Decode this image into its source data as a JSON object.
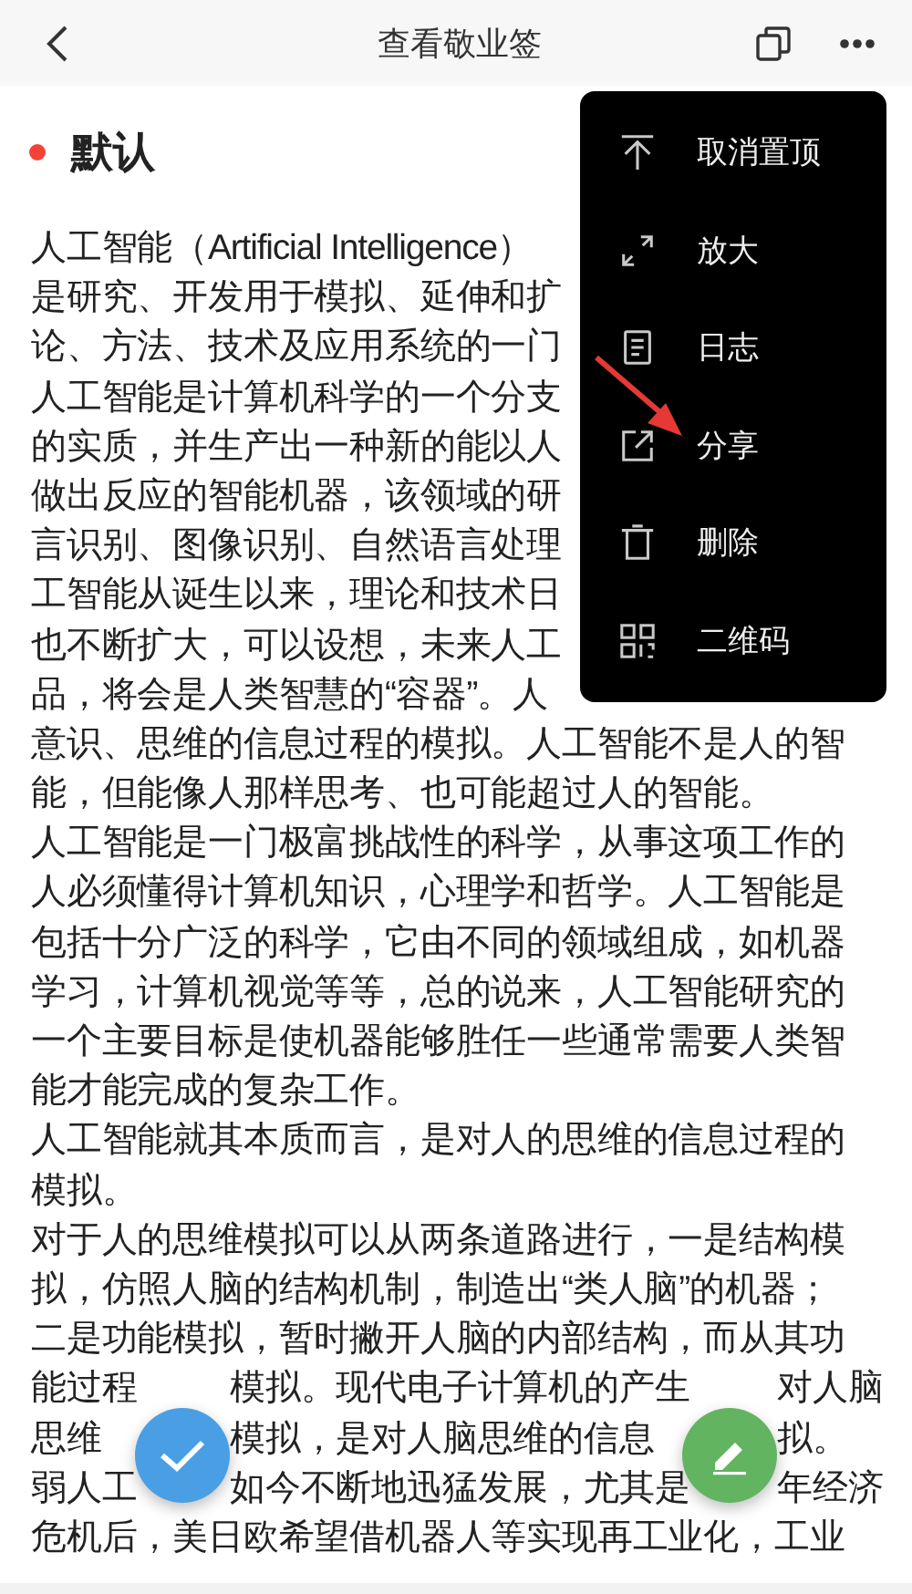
{
  "header": {
    "title": "查看敬业签"
  },
  "note": {
    "category": "默认",
    "lines": [
      [
        "人工智能（Artificial Intelligence）"
      ],
      [
        "是研究、开发用于模拟、延伸和扩"
      ],
      [
        "论、方法、技术及应用系统的一门"
      ],
      [
        "人工智能是计算机科学的一个分支"
      ],
      [
        "的实质，并生产出一种新的能以人"
      ],
      [
        "做出反应的智能机器，该领域的研"
      ],
      [
        "言识别、图像识别、自然语言处理"
      ],
      [
        "工智能从诞生以来，理论和技术日"
      ],
      [
        "也不断扩大，可以设想，未来人工"
      ],
      [
        "品，将会是人类智慧的“容器”。人"
      ],
      [
        "意识、思维的信息过程的模拟。人工智能不是人的智"
      ],
      [
        "能，但能像人那样思考、也可能超过人的智能。"
      ],
      [
        "人工智能是一门极富挑战性的科学，从事这项工作的"
      ],
      [
        "人必须懂得计算机知识，心理学和哲学。人工智能是"
      ],
      [
        "包括十分广泛的科学，它由不同的领域组成，如机器"
      ],
      [
        "学习，计算机视觉等等，总的说来，人工智能研究的"
      ],
      [
        "一个主要目标是使机器能够胜任一些通常需要人类智"
      ],
      [
        "能才能完成的复杂工作。"
      ],
      [
        "人工智能就其本质而言，是对人的思维的信息过程的"
      ],
      [
        "模拟。"
      ],
      [
        "对于人的思维模拟可以从两条道路进行，一是结构模"
      ],
      [
        "拟，仿照人脑的结构机制，制造出“类人脑”的机器；"
      ],
      [
        "二是功能模拟，暂时撇开人脑的内部结构，而从其功"
      ],
      [
        "能过程",
        "模拟。现代电子计算机的产生",
        "对人脑"
      ],
      [
        "思维",
        "模拟，是对人脑思维的信息",
        "拟。"
      ],
      [
        "弱人工",
        "如今不断地迅猛发展，尤其是",
        "年经济"
      ],
      [
        "危机后，美日欧希望借机器人等实现再工业化，工业"
      ]
    ]
  },
  "menu": {
    "items": [
      {
        "kind": "unpin",
        "label": "取消置顶"
      },
      {
        "kind": "expand",
        "label": "放大"
      },
      {
        "kind": "log",
        "label": "日志"
      },
      {
        "kind": "share",
        "label": "分享"
      },
      {
        "kind": "delete",
        "label": "删除"
      },
      {
        "kind": "qrcode",
        "label": "二维码"
      }
    ]
  },
  "fabs": [
    {
      "kind": "check"
    },
    {
      "kind": "edit"
    }
  ]
}
